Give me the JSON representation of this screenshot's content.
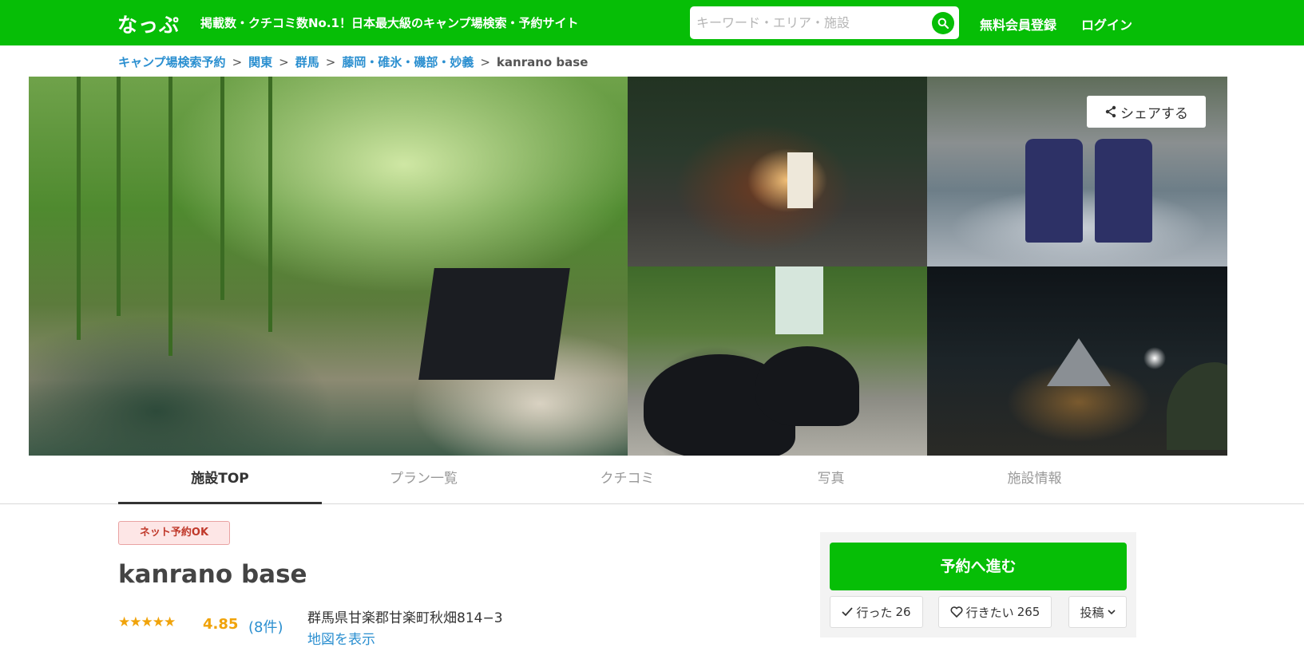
{
  "header": {
    "logo": "なっぷ",
    "tagline": "掲載数・クチコミ数No.1！日本最大級のキャンプ場検索・予約サイト",
    "search_placeholder": "キーワード・エリア・施設",
    "search_icon": "search-icon",
    "signup_label": "無料会員登録",
    "login_label": "ログイン",
    "brand_color": "#06be06"
  },
  "breadcrumb": {
    "items": [
      "キャンプ場検索予約",
      "関東",
      "群馬",
      "藤岡・碓氷・磯部・妙義"
    ],
    "current": "kanrano base",
    "separator": ">"
  },
  "gallery": {
    "share_label": "シェアする",
    "share_icon": "share-icon"
  },
  "tabs": [
    {
      "label": "施設TOP",
      "active": true
    },
    {
      "label": "プラン一覧",
      "active": false
    },
    {
      "label": "クチコミ",
      "active": false
    },
    {
      "label": "写真",
      "active": false
    },
    {
      "label": "施設情報",
      "active": false
    }
  ],
  "facility": {
    "badge": "ネット予約OK",
    "name": "kanrano base",
    "stars": "★★★★★",
    "rating": "4.85",
    "review_count": "(8件)",
    "address": "群馬県甘楽郡甘楽町秋畑814−3",
    "map_link": "地図を表示"
  },
  "actions": {
    "reserve_label": "予約へ進む",
    "went_label": "行った",
    "went_count": "26",
    "want_label": "行きたい",
    "want_count": "265",
    "post_label": "投稿",
    "check_icon": "check-icon",
    "heart_icon": "heart-icon",
    "chevron_icon": "chevron-down-icon"
  }
}
